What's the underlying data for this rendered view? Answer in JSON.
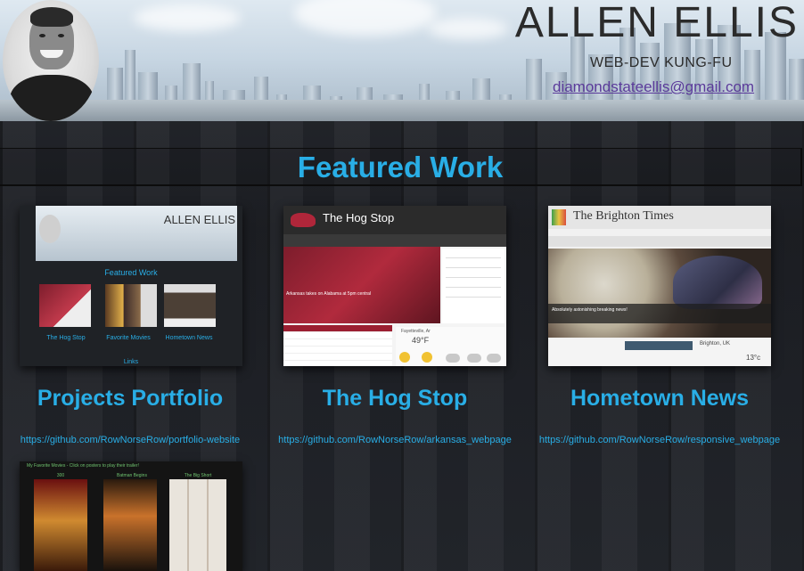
{
  "header": {
    "name": "ALLEN ELLIS",
    "tagline": "WEB-DEV KUNG-FU",
    "email": "diamondstateellis@gmail.com"
  },
  "section": {
    "title": "Featured Work"
  },
  "projects": [
    {
      "title": "Projects Portfolio",
      "link": "https://github.com/RowNorseRow/portfolio-website",
      "thumb": {
        "name": "ALLEN ELLIS",
        "section": "Featured Work",
        "labels": [
          "The Hog Stop",
          "Favorite Movies",
          "Hometown News"
        ],
        "footer": "Links"
      }
    },
    {
      "title": "The Hog Stop",
      "link": "https://github.com/RowNorseRow/arkansas_webpage",
      "thumb": {
        "title": "The Hog Stop",
        "caption": "Arkansas takes on Alabama at 5pm central",
        "temp": "49°F",
        "city": "Fayetteville, Ar"
      }
    },
    {
      "title": "Hometown News",
      "link": "https://github.com/RowNorseRow/responsive_webpage",
      "thumb": {
        "title": "The Brighton Times",
        "caption": "Absolutely astonishing breaking news!",
        "city": "Brighton, UK",
        "temp": "13°c"
      }
    }
  ],
  "movies_thumb": {
    "heading": "My Favorite Movies - Click on posters to play their trailer!",
    "labels": [
      "300",
      "Batman Begins",
      "The Big Short"
    ]
  },
  "colors": {
    "accent": "#29aee6",
    "email_link": "#5a3a9a",
    "background": "#1d1f24"
  }
}
